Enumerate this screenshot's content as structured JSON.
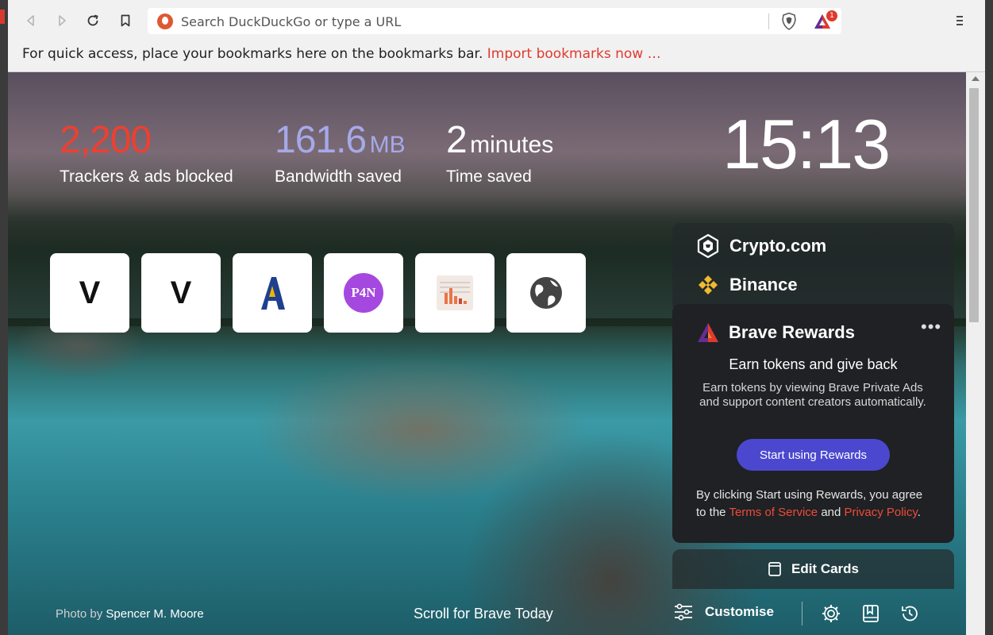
{
  "toolbar": {
    "search_placeholder": "Search DuckDuckGo or type a URL",
    "rewards_badge": "1"
  },
  "bookmarks_bar": {
    "message": "For quick access, place your bookmarks here on the bookmarks bar.",
    "import_link": "Import bookmarks now …"
  },
  "stats": {
    "trackers": {
      "value": "2,200",
      "label": "Trackers & ads blocked"
    },
    "bandwidth": {
      "value": "161.6",
      "unit": "MB",
      "label": "Bandwidth saved"
    },
    "time": {
      "value": "2",
      "unit": "minutes",
      "label": "Time saved"
    }
  },
  "clock": "15:13",
  "top_sites": [
    {
      "icon": "v-logo",
      "text": "V"
    },
    {
      "icon": "v-logo",
      "text": "V"
    },
    {
      "icon": "a-logo",
      "text": ""
    },
    {
      "icon": "p4n-logo",
      "text": "P4N"
    },
    {
      "icon": "chart-thumbnail",
      "text": ""
    },
    {
      "icon": "globe-icon",
      "text": ""
    }
  ],
  "cards": {
    "crypto": "Crypto.com",
    "binance": "Binance",
    "rewards": {
      "title": "Brave Rewards",
      "more": "•••",
      "heading": "Earn tokens and give back",
      "description": "Earn tokens by viewing Brave Private Ads and support content creators automatically.",
      "button": "Start using Rewards",
      "terms_prefix": "By clicking Start using Rewards, you agree to the",
      "terms_link": "Terms of Service",
      "terms_and": "and",
      "privacy_link": "Privacy Policy",
      "terms_suffix": "."
    },
    "edit_cards": "Edit Cards"
  },
  "footer": {
    "photo_by": "Photo by",
    "photographer": "Spencer M. Moore",
    "scroll_text": "Scroll for Brave Today",
    "customise": "Customise"
  },
  "colors": {
    "trackers_accent": "#ef3f2f",
    "bandwidth_accent": "#a6a9e8",
    "rewards_button": "#4b48cf",
    "link_red": "#ef4b3a"
  }
}
